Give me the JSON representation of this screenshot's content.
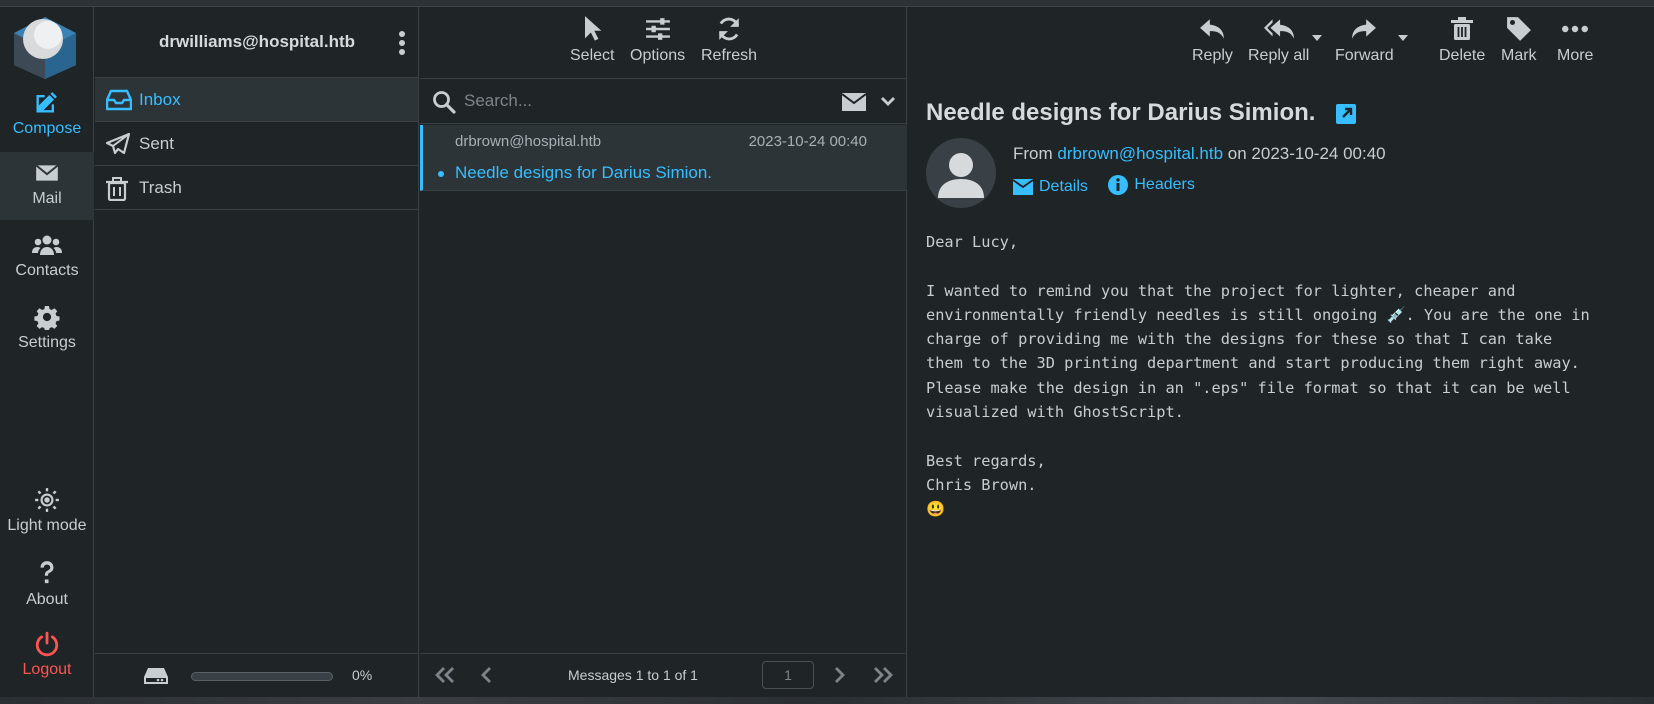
{
  "rail": {
    "compose": "Compose",
    "mail": "Mail",
    "contacts": "Contacts",
    "settings": "Settings",
    "light_mode": "Light mode",
    "about": "About",
    "logout": "Logout"
  },
  "folders": {
    "account": "drwilliams@hospital.htb",
    "items": [
      {
        "label": "Inbox",
        "icon": "inbox-icon"
      },
      {
        "label": "Sent",
        "icon": "paper-plane-icon"
      },
      {
        "label": "Trash",
        "icon": "trash-icon"
      }
    ],
    "quota_percent_label": "0%",
    "quota_fraction": 0
  },
  "list_toolbar": {
    "select": "Select",
    "options": "Options",
    "refresh": "Refresh"
  },
  "search": {
    "placeholder": "Search...",
    "value": ""
  },
  "messages": [
    {
      "from": "drbrown@hospital.htb",
      "date": "2023-10-24 00:40",
      "subject": "Needle designs for Darius Simion."
    }
  ],
  "pager": {
    "count": "Messages 1 to 1 of 1",
    "page": "1"
  },
  "reader_toolbar": {
    "reply": "Reply",
    "reply_all": "Reply all",
    "forward": "Forward",
    "delete": "Delete",
    "mark": "Mark",
    "more": "More"
  },
  "message": {
    "subject": "Needle designs for Darius Simion.",
    "from_prefix": "From",
    "from_address": "drbrown@hospital.htb",
    "on_text": "on 2023-10-24 00:40",
    "details": "Details",
    "headers": "Headers",
    "body": "Dear Lucy,\n\nI wanted to remind you that the project for lighter, cheaper and\nenvironmentally friendly needles is still ongoing 💉. You are the one in\ncharge of providing me with the designs for these so that I can take\nthem to the 3D printing department and start producing them right away.\nPlease make the design in an \".eps\" file format so that it can be well\nvisualized with GhostScript.\n\nBest regards,\nChris Brown.\n😃"
  },
  "colors": {
    "accent": "#37beff",
    "logout": "#ff5552",
    "background": "#1f2427",
    "selected": "#2d3438"
  }
}
